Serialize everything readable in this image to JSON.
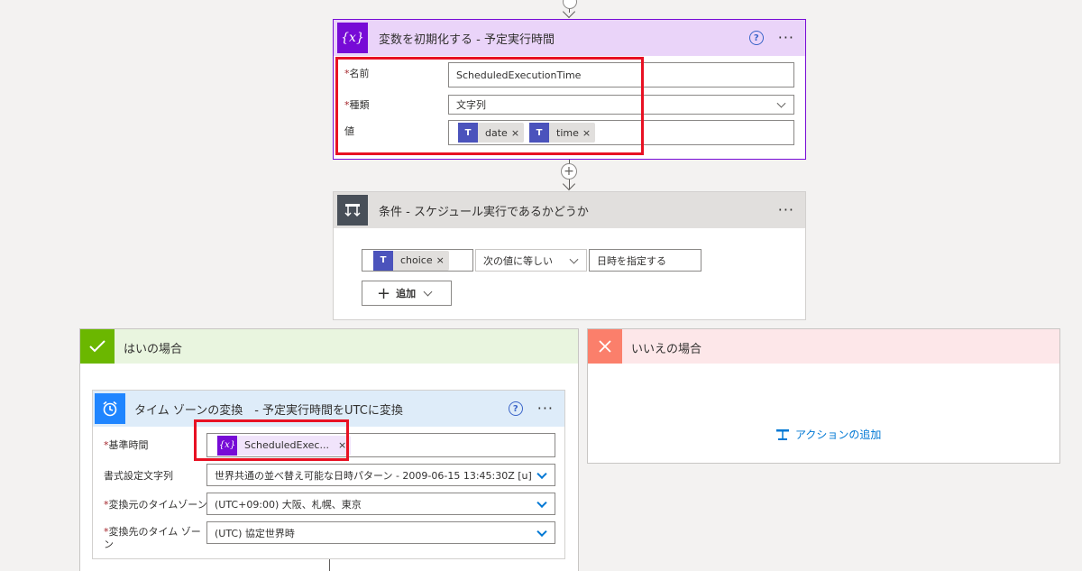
{
  "init_var": {
    "title": "変数を初期化する - 予定実行時間",
    "icon": "{x}",
    "name_label": "名前",
    "name_value": "ScheduledExecutionTime",
    "type_label": "種類",
    "type_value": "文字列",
    "value_label": "値",
    "tokens": [
      {
        "label": "date",
        "icon": "teams-icon"
      },
      {
        "label": "time",
        "icon": "teams-icon"
      }
    ]
  },
  "condition": {
    "title": "条件 - スケジュール実行であるかどうか",
    "token_label": "choice",
    "operator": "次の値に等しい",
    "value": "日時を指定する",
    "add_label": "追加"
  },
  "yes_branch": {
    "title": "はいの場合",
    "tz_card": {
      "title": "タイム ゾーンの変換　- 予定実行時間をUTCに変換",
      "base_time_label": "基準時間",
      "base_time_token": "ScheduledExec...",
      "format_label": "書式設定文字列",
      "format_value": "世界共通の並べ替え可能な日時パターン - 2009-06-15 13:45:30Z [u]",
      "source_tz_label": "変換元のタイムゾーン",
      "source_tz_value": "(UTC+09:00) 大阪、札幌、東京",
      "dest_tz_label": "変換先のタイム ゾーン",
      "dest_tz_value": "(UTC) 協定世界時"
    }
  },
  "no_branch": {
    "title": "いいえの場合",
    "add_action_label": "アクションの追加"
  },
  "colors": {
    "variable_purple": "#770bd6",
    "condition_dark": "#484f58",
    "yes_green": "#6bb700",
    "no_red": "#fb7f6b",
    "tz_blue": "#1f85ff",
    "highlight_red": "#e81123"
  }
}
